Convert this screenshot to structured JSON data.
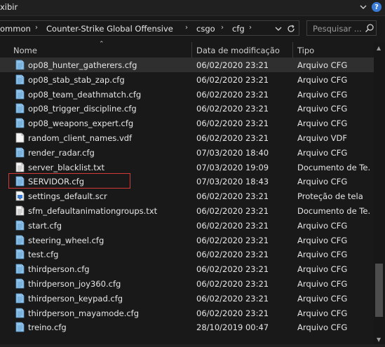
{
  "ribbon": {
    "menu_label": "xibir",
    "collapse_icon": "chevron-down-icon",
    "help_icon": "help-icon",
    "help_text": "?"
  },
  "address": {
    "crumbs": [
      "ommon",
      "Counter-Strike Global Offensive",
      "csgo",
      "cfg"
    ],
    "separator": "›",
    "dropdown_icon": "chevron-down-icon",
    "refresh_icon": "refresh-icon"
  },
  "search": {
    "placeholder": "Pesquisar ..."
  },
  "columns": {
    "name": "Nome",
    "date": "Data de modificação",
    "type": "Tipo"
  },
  "colors": {
    "highlight": "#d23a3a",
    "cfg_icon": "#8fc3ea",
    "selected_row": "#2f2f2f"
  },
  "files": [
    {
      "name": "op08_hunter_gatherers.cfg",
      "date": "06/02/2020 23:21",
      "type": "Arquivo CFG",
      "icon": "cfg",
      "selected": true
    },
    {
      "name": "op08_stab_stab_zap.cfg",
      "date": "06/02/2020 23:21",
      "type": "Arquivo CFG",
      "icon": "cfg"
    },
    {
      "name": "op08_team_deathmatch.cfg",
      "date": "06/02/2020 23:21",
      "type": "Arquivo CFG",
      "icon": "cfg"
    },
    {
      "name": "op08_trigger_discipline.cfg",
      "date": "06/02/2020 23:21",
      "type": "Arquivo CFG",
      "icon": "cfg"
    },
    {
      "name": "op08_weapons_expert.cfg",
      "date": "06/02/2020 23:21",
      "type": "Arquivo CFG",
      "icon": "cfg"
    },
    {
      "name": "random_client_names.vdf",
      "date": "06/02/2020 23:21",
      "type": "Arquivo VDF",
      "icon": "blank"
    },
    {
      "name": "render_radar.cfg",
      "date": "07/03/2020 18:40",
      "type": "Arquivo CFG",
      "icon": "cfg"
    },
    {
      "name": "server_blacklist.txt",
      "date": "07/03/2020 19:09",
      "type": "Documento de Te...",
      "icon": "text"
    },
    {
      "name": "SERVIDOR.cfg",
      "date": "07/03/2020 18:43",
      "type": "Arquivo CFG",
      "icon": "cfg",
      "highlighted": true
    },
    {
      "name": "settings_default.scr",
      "date": "06/02/2020 23:21",
      "type": "Proteção de tela",
      "icon": "screensaver"
    },
    {
      "name": "sfm_defaultanimationgroups.txt",
      "date": "06/02/2020 23:21",
      "type": "Documento de Te...",
      "icon": "text"
    },
    {
      "name": "start.cfg",
      "date": "06/02/2020 23:21",
      "type": "Arquivo CFG",
      "icon": "cfg"
    },
    {
      "name": "steering_wheel.cfg",
      "date": "06/02/2020 23:21",
      "type": "Arquivo CFG",
      "icon": "cfg"
    },
    {
      "name": "test.cfg",
      "date": "06/02/2020 23:21",
      "type": "Arquivo CFG",
      "icon": "cfg"
    },
    {
      "name": "thirdperson.cfg",
      "date": "06/02/2020 23:21",
      "type": "Arquivo CFG",
      "icon": "cfg"
    },
    {
      "name": "thirdperson_joy360.cfg",
      "date": "06/02/2020 23:21",
      "type": "Arquivo CFG",
      "icon": "cfg"
    },
    {
      "name": "thirdperson_keypad.cfg",
      "date": "06/02/2020 23:21",
      "type": "Arquivo CFG",
      "icon": "cfg"
    },
    {
      "name": "thirdperson_mayamode.cfg",
      "date": "06/02/2020 23:21",
      "type": "Arquivo CFG",
      "icon": "cfg"
    },
    {
      "name": "treino.cfg",
      "date": "28/10/2019 00:47",
      "type": "Arquivo CFG",
      "icon": "cfg"
    }
  ]
}
